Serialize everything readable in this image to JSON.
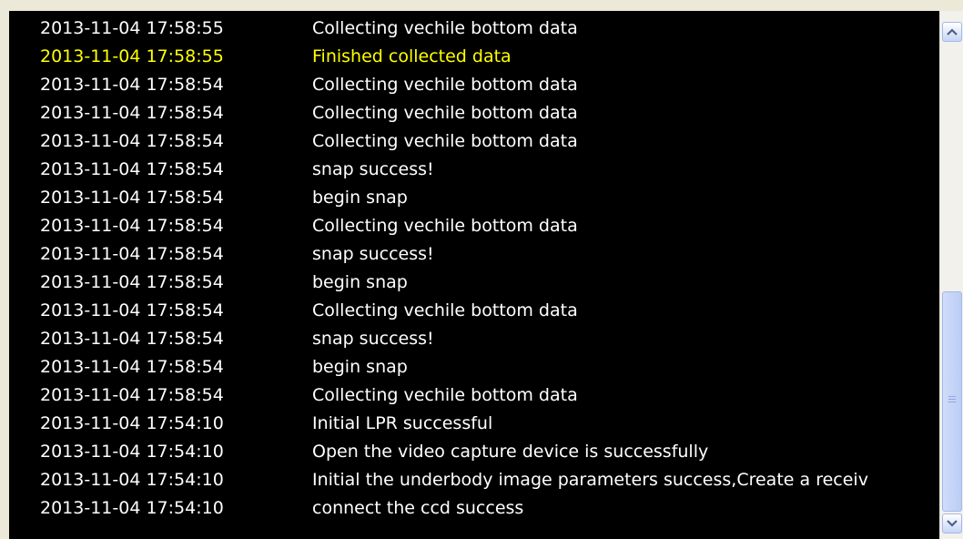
{
  "log": {
    "rows": [
      {
        "time": "2013-11-04 17:58:55",
        "message": "Collecting vechile bottom data",
        "highlight": false
      },
      {
        "time": "2013-11-04 17:58:55",
        "message": "Finished collected data",
        "highlight": true
      },
      {
        "time": "2013-11-04 17:58:54",
        "message": "Collecting vechile bottom data",
        "highlight": false
      },
      {
        "time": "2013-11-04 17:58:54",
        "message": "Collecting vechile bottom data",
        "highlight": false
      },
      {
        "time": "2013-11-04 17:58:54",
        "message": "Collecting vechile bottom data",
        "highlight": false
      },
      {
        "time": "2013-11-04 17:58:54",
        "message": "snap success!",
        "highlight": false
      },
      {
        "time": "2013-11-04 17:58:54",
        "message": "begin snap",
        "highlight": false
      },
      {
        "time": "2013-11-04 17:58:54",
        "message": "Collecting vechile bottom data",
        "highlight": false
      },
      {
        "time": "2013-11-04 17:58:54",
        "message": "snap success!",
        "highlight": false
      },
      {
        "time": "2013-11-04 17:58:54",
        "message": "begin snap",
        "highlight": false
      },
      {
        "time": "2013-11-04 17:58:54",
        "message": "Collecting vechile bottom data",
        "highlight": false
      },
      {
        "time": "2013-11-04 17:58:54",
        "message": "snap success!",
        "highlight": false
      },
      {
        "time": "2013-11-04 17:58:54",
        "message": "begin snap",
        "highlight": false
      },
      {
        "time": "2013-11-04 17:58:54",
        "message": "Collecting vechile bottom data",
        "highlight": false
      },
      {
        "time": "2013-11-04 17:54:10",
        "message": "Initial LPR successful",
        "highlight": false
      },
      {
        "time": "2013-11-04 17:54:10",
        "message": "Open the video capture device is successfully",
        "highlight": false
      },
      {
        "time": "2013-11-04 17:54:10",
        "message": "Initial the underbody image parameters success,Create a receiv",
        "highlight": false
      },
      {
        "time": "2013-11-04 17:54:10",
        "message": "connect the ccd success",
        "highlight": false
      }
    ]
  },
  "colors": {
    "background": "#000000",
    "text": "#ffffff",
    "highlight": "#ffff00",
    "scrollbar_track": "#f2f1ec",
    "scrollbar_thumb": "#c6d4f7"
  },
  "scrollbar": {
    "up_icon": "chevron-up-icon",
    "down_icon": "chevron-down-icon",
    "grip_icon": "grip-icon"
  }
}
